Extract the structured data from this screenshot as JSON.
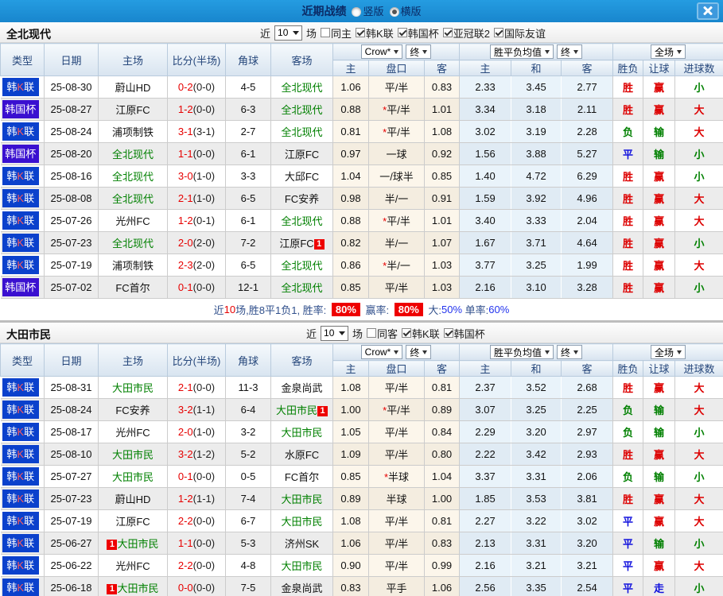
{
  "titlebar": {
    "title": "近期战绩",
    "radios": [
      {
        "label": "竖版",
        "selected": false
      },
      {
        "label": "横版",
        "selected": true
      }
    ],
    "close_icon": "close-x"
  },
  "table_header": {
    "left_columns": [
      "类型",
      "日期",
      "主场",
      "比分(半场)",
      "角球",
      "客场"
    ],
    "group1": {
      "dropdown": "Crow*",
      "final_dropdown": "终",
      "columns": [
        "主",
        "盘口",
        "客"
      ]
    },
    "group2": {
      "dropdown": "胜平负均值",
      "final_dropdown": "终",
      "columns": [
        "主",
        "和",
        "客"
      ]
    },
    "group3": {
      "dropdown": "全场",
      "columns": [
        "胜负",
        "让球",
        "进球数"
      ]
    }
  },
  "colors": {
    "kleague_badge": "#0b41cc",
    "cup_badge": "#3a10d0",
    "team_highlight": "#008000",
    "win": "#dd0000",
    "lose": "#008000",
    "draw": "#1010dd"
  },
  "sections": [
    {
      "team": "全北现代",
      "filter": {
        "near_label": "近",
        "count": "10",
        "games_label": "场",
        "checkboxes": [
          {
            "label": "同主",
            "checked": false
          },
          {
            "label": "韩K联",
            "checked": true
          },
          {
            "label": "韩国杯",
            "checked": true
          },
          {
            "label": "亚冠联2",
            "checked": true
          },
          {
            "label": "国际友谊",
            "checked": true
          }
        ]
      },
      "rows": [
        {
          "league": "韩K联",
          "lt": "k",
          "date": "25-08-30",
          "home": "蔚山HD",
          "home_hl": false,
          "home_badge": "",
          "score": "0-2",
          "half": "(0-0)",
          "corner": "4-5",
          "away": "全北现代",
          "away_hl": true,
          "away_badge": "",
          "o1": "1.06",
          "star": false,
          "pan": "平/半",
          "o2": "0.83",
          "a1": "2.33",
          "a2": "3.45",
          "a3": "2.77",
          "res": "胜",
          "res_c": "r",
          "hres": "赢",
          "hres_c": "r",
          "goal": "小",
          "goal_c": "g"
        },
        {
          "league": "韩国杯",
          "lt": "cup",
          "date": "25-08-27",
          "home": "江原FC",
          "home_hl": false,
          "home_badge": "",
          "score": "1-2",
          "half": "(0-0)",
          "corner": "6-3",
          "away": "全北现代",
          "away_hl": true,
          "away_badge": "",
          "o1": "0.88",
          "star": true,
          "pan": "平/半",
          "o2": "1.01",
          "a1": "3.34",
          "a2": "3.18",
          "a3": "2.11",
          "res": "胜",
          "res_c": "r",
          "hres": "赢",
          "hres_c": "r",
          "goal": "大",
          "goal_c": "r"
        },
        {
          "league": "韩K联",
          "lt": "k",
          "date": "25-08-24",
          "home": "浦项制铁",
          "home_hl": false,
          "home_badge": "",
          "score": "3-1",
          "half": "(3-1)",
          "corner": "2-7",
          "away": "全北现代",
          "away_hl": true,
          "away_badge": "",
          "o1": "0.81",
          "star": true,
          "pan": "平/半",
          "o2": "1.08",
          "a1": "3.02",
          "a2": "3.19",
          "a3": "2.28",
          "res": "负",
          "res_c": "g",
          "hres": "输",
          "hres_c": "g",
          "goal": "大",
          "goal_c": "r"
        },
        {
          "league": "韩国杯",
          "lt": "cup",
          "date": "25-08-20",
          "home": "全北现代",
          "home_hl": true,
          "home_badge": "",
          "score": "1-1",
          "half": "(0-0)",
          "corner": "6-1",
          "away": "江原FC",
          "away_hl": false,
          "away_badge": "",
          "o1": "0.97",
          "star": false,
          "pan": "一球",
          "o2": "0.92",
          "a1": "1.56",
          "a2": "3.88",
          "a3": "5.27",
          "res": "平",
          "res_c": "b",
          "hres": "输",
          "hres_c": "g",
          "goal": "小",
          "goal_c": "g"
        },
        {
          "league": "韩K联",
          "lt": "k",
          "date": "25-08-16",
          "home": "全北现代",
          "home_hl": true,
          "home_badge": "",
          "score": "3-0",
          "half": "(1-0)",
          "corner": "3-3",
          "away": "大邱FC",
          "away_hl": false,
          "away_badge": "",
          "o1": "1.04",
          "star": false,
          "pan": "一/球半",
          "o2": "0.85",
          "a1": "1.40",
          "a2": "4.72",
          "a3": "6.29",
          "res": "胜",
          "res_c": "r",
          "hres": "赢",
          "hres_c": "r",
          "goal": "小",
          "goal_c": "g"
        },
        {
          "league": "韩K联",
          "lt": "k",
          "date": "25-08-08",
          "home": "全北现代",
          "home_hl": true,
          "home_badge": "",
          "score": "2-1",
          "half": "(1-0)",
          "corner": "6-5",
          "away": "FC安养",
          "away_hl": false,
          "away_badge": "",
          "o1": "0.98",
          "star": false,
          "pan": "半/一",
          "o2": "0.91",
          "a1": "1.59",
          "a2": "3.92",
          "a3": "4.96",
          "res": "胜",
          "res_c": "r",
          "hres": "赢",
          "hres_c": "r",
          "goal": "大",
          "goal_c": "r"
        },
        {
          "league": "韩K联",
          "lt": "k",
          "date": "25-07-26",
          "home": "光州FC",
          "home_hl": false,
          "home_badge": "",
          "score": "1-2",
          "half": "(0-1)",
          "corner": "6-1",
          "away": "全北现代",
          "away_hl": true,
          "away_badge": "",
          "o1": "0.88",
          "star": true,
          "pan": "平/半",
          "o2": "1.01",
          "a1": "3.40",
          "a2": "3.33",
          "a3": "2.04",
          "res": "胜",
          "res_c": "r",
          "hres": "赢",
          "hres_c": "r",
          "goal": "大",
          "goal_c": "r"
        },
        {
          "league": "韩K联",
          "lt": "k",
          "date": "25-07-23",
          "home": "全北现代",
          "home_hl": true,
          "home_badge": "",
          "score": "2-0",
          "half": "(2-0)",
          "corner": "7-2",
          "away": "江原FC",
          "away_hl": false,
          "away_badge": "1",
          "o1": "0.82",
          "star": false,
          "pan": "半/一",
          "o2": "1.07",
          "a1": "1.67",
          "a2": "3.71",
          "a3": "4.64",
          "res": "胜",
          "res_c": "r",
          "hres": "赢",
          "hres_c": "r",
          "goal": "小",
          "goal_c": "g"
        },
        {
          "league": "韩K联",
          "lt": "k",
          "date": "25-07-19",
          "home": "浦项制铁",
          "home_hl": false,
          "home_badge": "",
          "score": "2-3",
          "half": "(2-0)",
          "corner": "6-5",
          "away": "全北现代",
          "away_hl": true,
          "away_badge": "",
          "o1": "0.86",
          "star": true,
          "pan": "半/一",
          "o2": "1.03",
          "a1": "3.77",
          "a2": "3.25",
          "a3": "1.99",
          "res": "胜",
          "res_c": "r",
          "hres": "赢",
          "hres_c": "r",
          "goal": "大",
          "goal_c": "r"
        },
        {
          "league": "韩国杯",
          "lt": "cup",
          "date": "25-07-02",
          "home": "FC首尔",
          "home_hl": false,
          "home_badge": "",
          "score": "0-1",
          "half": "(0-0)",
          "corner": "12-1",
          "away": "全北现代",
          "away_hl": true,
          "away_badge": "",
          "o1": "0.85",
          "star": false,
          "pan": "平/半",
          "o2": "1.03",
          "a1": "2.16",
          "a2": "3.10",
          "a3": "3.28",
          "res": "胜",
          "res_c": "r",
          "hres": "赢",
          "hres_c": "r",
          "goal": "小",
          "goal_c": "g"
        }
      ],
      "summary": [
        {
          "text": "近",
          "style": "navy"
        },
        {
          "text": "10",
          "style": "red"
        },
        {
          "text": "场,胜8平1负1, 胜率: ",
          "style": "navy"
        },
        {
          "text": "80%",
          "style": "redbox"
        },
        {
          "text": " 赢率: ",
          "style": "navy"
        },
        {
          "text": "80%",
          "style": "redbox"
        },
        {
          "text": " 大:",
          "style": "navy"
        },
        {
          "text": "50%",
          "style": "blue"
        },
        {
          "text": " 单率:",
          "style": "navy"
        },
        {
          "text": "60%",
          "style": "blue"
        }
      ]
    },
    {
      "team": "大田市民",
      "filter": {
        "near_label": "近",
        "count": "10",
        "games_label": "场",
        "checkboxes": [
          {
            "label": "同客",
            "checked": false
          },
          {
            "label": "韩K联",
            "checked": true
          },
          {
            "label": "韩国杯",
            "checked": true
          }
        ]
      },
      "rows": [
        {
          "league": "韩K联",
          "lt": "k",
          "date": "25-08-31",
          "home": "大田市民",
          "home_hl": true,
          "home_badge": "",
          "score": "2-1",
          "half": "(0-0)",
          "corner": "11-3",
          "away": "金泉尚武",
          "away_hl": false,
          "away_badge": "",
          "o1": "1.08",
          "star": false,
          "pan": "平/半",
          "o2": "0.81",
          "a1": "2.37",
          "a2": "3.52",
          "a3": "2.68",
          "res": "胜",
          "res_c": "r",
          "hres": "赢",
          "hres_c": "r",
          "goal": "大",
          "goal_c": "r"
        },
        {
          "league": "韩K联",
          "lt": "k",
          "date": "25-08-24",
          "home": "FC安养",
          "home_hl": false,
          "home_badge": "",
          "score": "3-2",
          "half": "(1-1)",
          "corner": "6-4",
          "away": "大田市民",
          "away_hl": true,
          "away_badge": "1",
          "o1": "1.00",
          "star": true,
          "pan": "平/半",
          "o2": "0.89",
          "a1": "3.07",
          "a2": "3.25",
          "a3": "2.25",
          "res": "负",
          "res_c": "g",
          "hres": "输",
          "hres_c": "g",
          "goal": "大",
          "goal_c": "r"
        },
        {
          "league": "韩K联",
          "lt": "k",
          "date": "25-08-17",
          "home": "光州FC",
          "home_hl": false,
          "home_badge": "",
          "score": "2-0",
          "half": "(1-0)",
          "corner": "3-2",
          "away": "大田市民",
          "away_hl": true,
          "away_badge": "",
          "o1": "1.05",
          "star": false,
          "pan": "平/半",
          "o2": "0.84",
          "a1": "2.29",
          "a2": "3.20",
          "a3": "2.97",
          "res": "负",
          "res_c": "g",
          "hres": "输",
          "hres_c": "g",
          "goal": "小",
          "goal_c": "g"
        },
        {
          "league": "韩K联",
          "lt": "k",
          "date": "25-08-10",
          "home": "大田市民",
          "home_hl": true,
          "home_badge": "",
          "score": "3-2",
          "half": "(1-2)",
          "corner": "5-2",
          "away": "水原FC",
          "away_hl": false,
          "away_badge": "",
          "o1": "1.09",
          "star": false,
          "pan": "平/半",
          "o2": "0.80",
          "a1": "2.22",
          "a2": "3.42",
          "a3": "2.93",
          "res": "胜",
          "res_c": "r",
          "hres": "赢",
          "hres_c": "r",
          "goal": "大",
          "goal_c": "r"
        },
        {
          "league": "韩K联",
          "lt": "k",
          "date": "25-07-27",
          "home": "大田市民",
          "home_hl": true,
          "home_badge": "",
          "score": "0-1",
          "half": "(0-0)",
          "corner": "0-5",
          "away": "FC首尔",
          "away_hl": false,
          "away_badge": "",
          "o1": "0.85",
          "star": true,
          "pan": "半球",
          "o2": "1.04",
          "a1": "3.37",
          "a2": "3.31",
          "a3": "2.06",
          "res": "负",
          "res_c": "g",
          "hres": "输",
          "hres_c": "g",
          "goal": "小",
          "goal_c": "g"
        },
        {
          "league": "韩K联",
          "lt": "k",
          "date": "25-07-23",
          "home": "蔚山HD",
          "home_hl": false,
          "home_badge": "",
          "score": "1-2",
          "half": "(1-1)",
          "corner": "7-4",
          "away": "大田市民",
          "away_hl": true,
          "away_badge": "",
          "o1": "0.89",
          "star": false,
          "pan": "半球",
          "o2": "1.00",
          "a1": "1.85",
          "a2": "3.53",
          "a3": "3.81",
          "res": "胜",
          "res_c": "r",
          "hres": "赢",
          "hres_c": "r",
          "goal": "大",
          "goal_c": "r"
        },
        {
          "league": "韩K联",
          "lt": "k",
          "date": "25-07-19",
          "home": "江原FC",
          "home_hl": false,
          "home_badge": "",
          "score": "2-2",
          "half": "(0-0)",
          "corner": "6-7",
          "away": "大田市民",
          "away_hl": true,
          "away_badge": "",
          "o1": "1.08",
          "star": false,
          "pan": "平/半",
          "o2": "0.81",
          "a1": "2.27",
          "a2": "3.22",
          "a3": "3.02",
          "res": "平",
          "res_c": "b",
          "hres": "赢",
          "hres_c": "r",
          "goal": "大",
          "goal_c": "r"
        },
        {
          "league": "韩K联",
          "lt": "k",
          "date": "25-06-27",
          "home": "大田市民",
          "home_hl": true,
          "home_badge": "1",
          "score": "1-1",
          "half": "(0-0)",
          "corner": "5-3",
          "away": "济州SK",
          "away_hl": false,
          "away_badge": "",
          "o1": "1.06",
          "star": false,
          "pan": "平/半",
          "o2": "0.83",
          "a1": "2.13",
          "a2": "3.31",
          "a3": "3.20",
          "res": "平",
          "res_c": "b",
          "hres": "输",
          "hres_c": "g",
          "goal": "小",
          "goal_c": "g"
        },
        {
          "league": "韩K联",
          "lt": "k",
          "date": "25-06-22",
          "home": "光州FC",
          "home_hl": false,
          "home_badge": "",
          "score": "2-2",
          "half": "(0-0)",
          "corner": "4-8",
          "away": "大田市民",
          "away_hl": true,
          "away_badge": "",
          "o1": "0.90",
          "star": false,
          "pan": "平/半",
          "o2": "0.99",
          "a1": "2.16",
          "a2": "3.21",
          "a3": "3.21",
          "res": "平",
          "res_c": "b",
          "hres": "赢",
          "hres_c": "r",
          "goal": "大",
          "goal_c": "r"
        },
        {
          "league": "韩K联",
          "lt": "k",
          "date": "25-06-18",
          "home": "大田市民",
          "home_hl": true,
          "home_badge": "1",
          "score": "0-0",
          "half": "(0-0)",
          "corner": "7-5",
          "away": "金泉尚武",
          "away_hl": false,
          "away_badge": "",
          "o1": "0.83",
          "star": false,
          "pan": "平手",
          "o2": "1.06",
          "a1": "2.56",
          "a2": "3.35",
          "a3": "2.54",
          "res": "平",
          "res_c": "b",
          "hres": "走",
          "hres_c": "b",
          "goal": "小",
          "goal_c": "g"
        }
      ],
      "summary": null
    }
  ]
}
